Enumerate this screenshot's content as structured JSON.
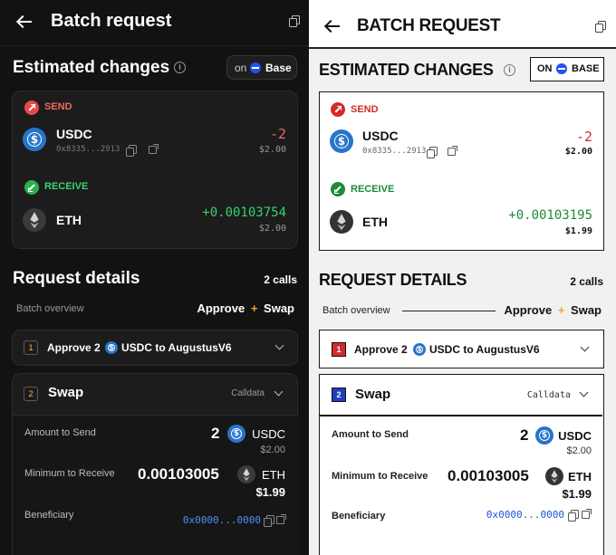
{
  "header": {
    "title_dark": "Batch request",
    "title_light": "BATCH REQUEST"
  },
  "estimated": {
    "title_dark": "Estimated changes",
    "title_light": "ESTIMATED CHANGES",
    "network_prefix": "on",
    "network_prefix_light": "ON",
    "network_name": "Base",
    "network_name_light": "BASE"
  },
  "send": {
    "label": "SEND",
    "token": "USDC",
    "address": "0x8335...2913",
    "amount": "-2",
    "usd": "$2.00"
  },
  "receive": {
    "label": "RECEIVE",
    "token": "ETH",
    "amount_dark": "+0.00103754",
    "usd_dark": "$2.00",
    "amount_light": "+0.00103195",
    "usd_light": "$1.99"
  },
  "request": {
    "title_dark": "Request details",
    "title_light": "REQUEST DETAILS",
    "calls": "2 calls",
    "overview_label": "Batch overview",
    "approve": "Approve",
    "plus": "+",
    "swap": "Swap"
  },
  "call1": {
    "number": "1",
    "prefix": "Approve 2",
    "suffix": "USDC to AugustusV6"
  },
  "call2": {
    "number": "2",
    "title": "Swap",
    "calldata": "Calldata",
    "amount_send_label": "Amount to Send",
    "amount_send_value": "2",
    "amount_send_token": "USDC",
    "amount_send_usd": "$2.00",
    "min_receive_label": "Minimum to Receive",
    "min_receive_value": "0.00103005",
    "min_receive_token": "ETH",
    "min_receive_usd": "$1.99",
    "beneficiary_label": "Beneficiary",
    "beneficiary_value": "0x0000...0000"
  },
  "colors": {
    "send_red": "#e5484d",
    "receive_green": "#22c55e",
    "approve_plus": "#f5a524",
    "link_blue": "#4f8ff7",
    "call1_badge_light": "#d22b2b",
    "call2_badge_light": "#1f3fbf"
  }
}
